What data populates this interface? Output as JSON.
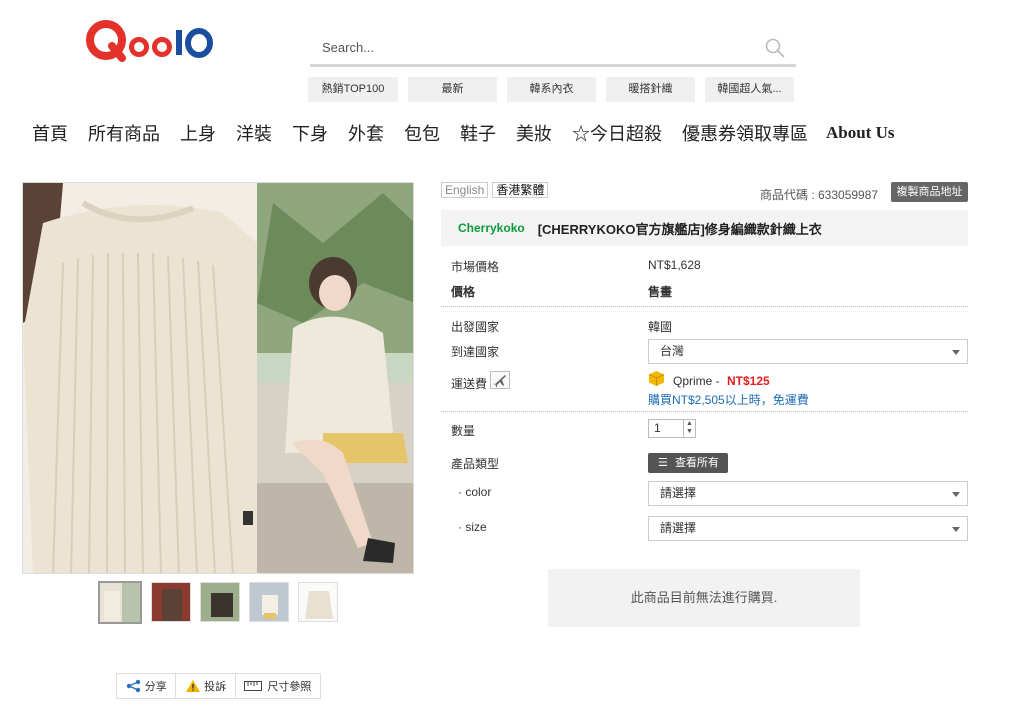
{
  "header": {
    "logo": "Qoo10",
    "search_placeholder": "Search...",
    "keywords": [
      "熱銷TOP100",
      "最新",
      "韓系內衣",
      "暖搭針織",
      "韓國超人氣..."
    ],
    "nav": [
      "首頁",
      "所有商品",
      "上身",
      "洋裝",
      "下身",
      "外套",
      "包包",
      "鞋子",
      "美妝",
      "☆今日超殺",
      "優惠券領取專區",
      "About Us"
    ]
  },
  "product": {
    "lang_en": "English",
    "lang_zh": "香港繁體",
    "code_text": "商品代碼 : 633059987",
    "copy_button": "複製商品地址",
    "seller": "Cherrykoko",
    "title": "[CHERRYKOKO官方旗艦店]修身編織款針織上衣",
    "market_price_label": "市場價格",
    "market_price": "NT$1,628",
    "price_label": "價格",
    "price": "售畫",
    "origin_label": "出發國家",
    "origin": "韓國",
    "dest_label": "到達國家",
    "dest": "台灣",
    "shipping_label": "運送費",
    "shipping_service": "Qprime - ",
    "shipping_price": "NT$125",
    "free_shipping": "購買NT$2,505以上時，免運費",
    "qty_label": "數量",
    "qty": "1",
    "type_label": "產品類型",
    "view_all": "查看所有",
    "color_label": "· color",
    "color_value": "請選擇",
    "size_label": "· size",
    "size_value": "請選擇",
    "unavailable": "此商品目前無法進行購買."
  },
  "share": {
    "share": "分享",
    "report": "投訴",
    "size": "尺寸參照"
  },
  "colors": {
    "brand_red": "#e4322b",
    "brand_blue": "#1a4fa0",
    "seller_green": "#0a9a3c",
    "price_red": "#e31d1d"
  }
}
